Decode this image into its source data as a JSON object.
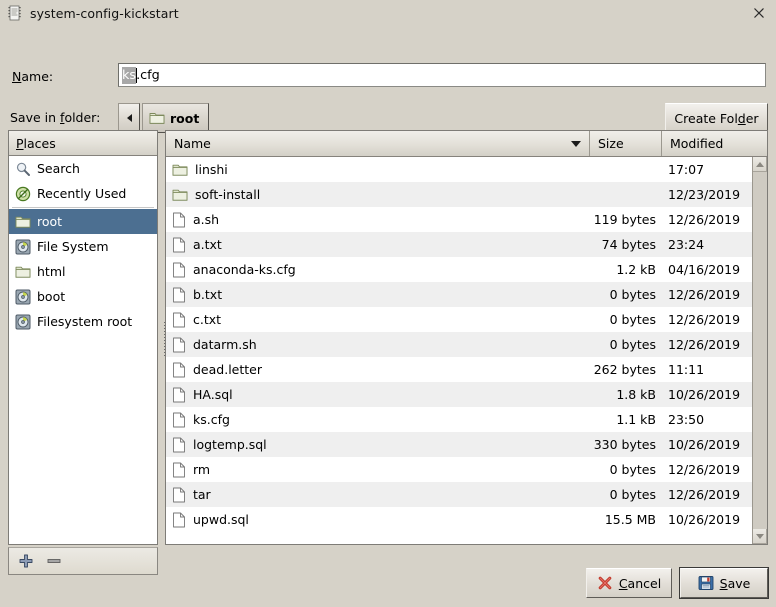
{
  "window": {
    "title": "system-config-kickstart",
    "icon": "app-kickstart-icon",
    "close_icon": "close-icon"
  },
  "form": {
    "name_label": "Name:",
    "name_label_accel": "N",
    "name_value_selected": "ks",
    "name_value_rest": ".cfg",
    "name_value": "ks.cfg",
    "save_in_folder_label": "Save in folder:",
    "save_in_folder_accel": "f",
    "back_button": "◀",
    "current_folder": "root",
    "create_folder_label": "Create Folder",
    "create_folder_accel": "d"
  },
  "places": {
    "header": "Places",
    "header_accel": "P",
    "items": [
      {
        "label": "Search",
        "icon": "search-icon",
        "selected": false
      },
      {
        "label": "Recently Used",
        "icon": "recent-icon",
        "selected": false
      },
      {
        "label": "root",
        "icon": "folder-icon",
        "selected": true
      },
      {
        "label": "File System",
        "icon": "drive-icon",
        "selected": false
      },
      {
        "label": "html",
        "icon": "folder-icon",
        "selected": false
      },
      {
        "label": "boot",
        "icon": "drive-icon",
        "selected": false
      },
      {
        "label": "Filesystem root",
        "icon": "drive-icon",
        "selected": false
      }
    ],
    "add_button": "add-place-button",
    "remove_button": "remove-place-button"
  },
  "filelist": {
    "columns": [
      "Name",
      "Size",
      "Modified"
    ],
    "sort_column": "Name",
    "sort_direction": "descending",
    "rows": [
      {
        "name": "linshi",
        "type": "folder",
        "size": "",
        "modified": "17:07"
      },
      {
        "name": "soft-install",
        "type": "folder",
        "size": "",
        "modified": "12/23/2019"
      },
      {
        "name": "a.sh",
        "type": "file",
        "size": "119 bytes",
        "modified": "12/26/2019"
      },
      {
        "name": "a.txt",
        "type": "file",
        "size": "74 bytes",
        "modified": "23:24"
      },
      {
        "name": "anaconda-ks.cfg",
        "type": "file",
        "size": "1.2 kB",
        "modified": "04/16/2019"
      },
      {
        "name": "b.txt",
        "type": "file",
        "size": "0 bytes",
        "modified": "12/26/2019"
      },
      {
        "name": "c.txt",
        "type": "file",
        "size": "0 bytes",
        "modified": "12/26/2019"
      },
      {
        "name": "datarm.sh",
        "type": "file",
        "size": "0 bytes",
        "modified": "12/26/2019"
      },
      {
        "name": "dead.letter",
        "type": "file",
        "size": "262 bytes",
        "modified": "11:11"
      },
      {
        "name": "HA.sql",
        "type": "file",
        "size": "1.8 kB",
        "modified": "10/26/2019"
      },
      {
        "name": "ks.cfg",
        "type": "file",
        "size": "1.1 kB",
        "modified": "23:50"
      },
      {
        "name": "logtemp.sql",
        "type": "file",
        "size": "330 bytes",
        "modified": "10/26/2019"
      },
      {
        "name": "rm",
        "type": "file",
        "size": "0 bytes",
        "modified": "12/26/2019"
      },
      {
        "name": "tar",
        "type": "file",
        "size": "0 bytes",
        "modified": "12/26/2019"
      },
      {
        "name": "upwd.sql",
        "type": "file",
        "size": "15.5 MB",
        "modified": "10/26/2019"
      }
    ]
  },
  "footer": {
    "cancel_label": "Cancel",
    "cancel_accel": "C",
    "cancel_icon": "cancel-x-icon",
    "save_label": "Save",
    "save_accel": "S",
    "save_icon": "floppy-save-icon"
  },
  "colors": {
    "window_bg": "#d6d2c8",
    "selection_blue": "#4c6f91",
    "row_alt": "#efefef",
    "text": "#000000"
  }
}
